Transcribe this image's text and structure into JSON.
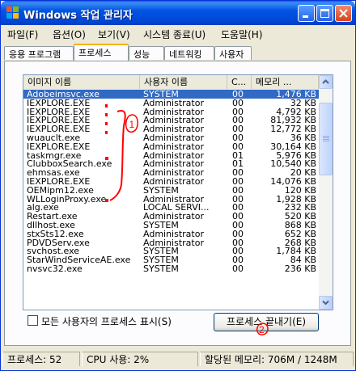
{
  "window": {
    "title": "Windows 작업 관리자",
    "icon": "task-manager-icon"
  },
  "menu": [
    "파일(F)",
    "옵션(O)",
    "보기(V)",
    "시스템 종료(U)",
    "도움말(H)"
  ],
  "tabs": [
    {
      "label": "응용 프로그램",
      "active": false
    },
    {
      "label": "프로세스",
      "active": true
    },
    {
      "label": "성능",
      "active": false
    },
    {
      "label": "네트워킹",
      "active": false
    },
    {
      "label": "사용자",
      "active": false
    }
  ],
  "columns": [
    "이미지 이름",
    "사용자 이름",
    "C...",
    "메모리 ..."
  ],
  "processes": [
    {
      "name": "Adobeimsvc.exe",
      "user": "SYSTEM",
      "cpu": "00",
      "mem": "1,476 KB",
      "selected": true
    },
    {
      "name": "IEXPLORE.EXE",
      "user": "Administrator",
      "cpu": "00",
      "mem": "32 KB"
    },
    {
      "name": "IEXPLORE.EXE",
      "user": "Administrator",
      "cpu": "00",
      "mem": "4,792 KB"
    },
    {
      "name": "IEXPLORE.EXE",
      "user": "Administrator",
      "cpu": "00",
      "mem": "81,932 KB"
    },
    {
      "name": "IEXPLORE.EXE",
      "user": "Administrator",
      "cpu": "00",
      "mem": "12,772 KB"
    },
    {
      "name": "wuauclt.exe",
      "user": "Administrator",
      "cpu": "00",
      "mem": "36 KB"
    },
    {
      "name": "IEXPLORE.EXE",
      "user": "Administrator",
      "cpu": "00",
      "mem": "30,164 KB"
    },
    {
      "name": "taskmgr.exe",
      "user": "Administrator",
      "cpu": "01",
      "mem": "5,976 KB"
    },
    {
      "name": "ClubboxSearch.exe",
      "user": "Administrator",
      "cpu": "01",
      "mem": "10,540 KB"
    },
    {
      "name": "ehmsas.exe",
      "user": "Administrator",
      "cpu": "00",
      "mem": "20 KB"
    },
    {
      "name": "IEXPLORE.EXE",
      "user": "Administrator",
      "cpu": "00",
      "mem": "14,076 KB"
    },
    {
      "name": "OEMipm12.exe",
      "user": "SYSTEM",
      "cpu": "00",
      "mem": "120 KB"
    },
    {
      "name": "WLLoginProxy.exe",
      "user": "Administrator",
      "cpu": "00",
      "mem": "1,928 KB"
    },
    {
      "name": "alg.exe",
      "user": "LOCAL SERVI...",
      "cpu": "00",
      "mem": "232 KB"
    },
    {
      "name": "Restart.exe",
      "user": "Administrator",
      "cpu": "00",
      "mem": "520 KB"
    },
    {
      "name": "dllhost.exe",
      "user": "SYSTEM",
      "cpu": "00",
      "mem": "868 KB"
    },
    {
      "name": "stxSts12.exe",
      "user": "Administrator",
      "cpu": "00",
      "mem": "652 KB"
    },
    {
      "name": "PDVDServ.exe",
      "user": "Administrator",
      "cpu": "00",
      "mem": "268 KB"
    },
    {
      "name": "svchost.exe",
      "user": "SYSTEM",
      "cpu": "00",
      "mem": "1,784 KB"
    },
    {
      "name": "StarWindServiceAE.exe",
      "user": "SYSTEM",
      "cpu": "00",
      "mem": "84 KB"
    },
    {
      "name": "nvsvc32.exe",
      "user": "SYSTEM",
      "cpu": "00",
      "mem": "236 KB"
    }
  ],
  "show_all_users_label": "모든 사용자의 프로세스 표시(S)",
  "end_process_label": "프로세스 끝내기(E)",
  "status": {
    "processes": "프로세스: 52",
    "cpu": "CPU 사용: 2%",
    "memory": "할당된 메모리: 706M / 1248M"
  },
  "colors": {
    "selection": "#316ac5",
    "title_bar": "#0054e3",
    "annotation": "#ff0000"
  },
  "annotation_marks": [
    "1",
    "2"
  ]
}
